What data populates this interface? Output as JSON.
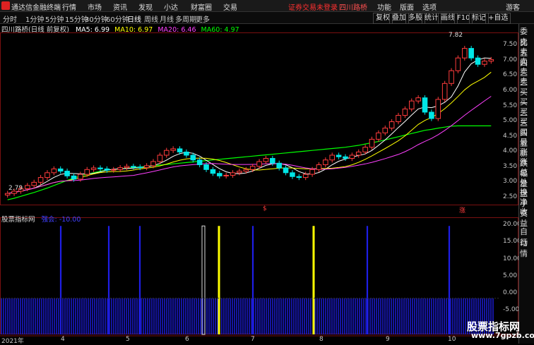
{
  "app": {
    "title": "通达信金融终端",
    "menus": [
      "行情",
      "市场",
      "资讯",
      "发现",
      "小达",
      "财富圈",
      "交易"
    ],
    "login_warning": "证券交易未登录",
    "stock_tab": "四川路桥",
    "right_menus": [
      "功能",
      "版面",
      "选项"
    ],
    "user": "游客"
  },
  "periods": [
    "分时",
    "1分钟",
    "5分钟",
    "15分钟",
    "30分钟",
    "60分钟",
    "日线",
    "周线",
    "月线",
    "多周期",
    "更多"
  ],
  "active_period": "日线",
  "toolbar_buttons": [
    "复权",
    "叠加",
    "多股",
    "统计",
    "画线",
    "F10",
    "标记",
    "+自选"
  ],
  "chart_header": {
    "stock_label": "四川路桥(日线 前复权)",
    "ma": [
      {
        "label": "MA5: 6.99",
        "color": "#ffffff"
      },
      {
        "label": "MA10: 6.97",
        "color": "#ffff00"
      },
      {
        "label": "MA20: 6.46",
        "color": "#ff40ff"
      },
      {
        "label": "MA60: 4.97",
        "color": "#00ff00"
      }
    ]
  },
  "price_axis": [
    "7.50",
    "7.00",
    "6.50",
    "6.00",
    "5.50",
    "5.00",
    "4.50",
    "4.00",
    "3.50",
    "3.00",
    "2.50"
  ],
  "price_marks": {
    "high": "7.82",
    "low": "2.79"
  },
  "event_markers": [
    "$",
    "涨"
  ],
  "indicator_header": {
    "name": "股票指标网",
    "value_label": "强会: -10.00"
  },
  "indicator_axis": [
    "20.00",
    "15.00",
    "10.00",
    "5.00",
    "0.00",
    "-5.00"
  ],
  "x_axis": [
    "2021年",
    "4",
    "5",
    "6",
    "7",
    "8",
    "9",
    "10"
  ],
  "right_panel": [
    "委比",
    "卖五",
    "卖四",
    "卖三",
    "卖二",
    "卖一",
    "买一",
    "买二",
    "买三",
    "买四",
    "买五",
    "最新",
    "涨跌",
    "涨幅",
    "总量",
    "外盘",
    "换手",
    "净资",
    "收益"
  ],
  "right_panel_bottom": [
    "自动",
    "行情"
  ],
  "watermark": {
    "line1": "股票指标网",
    "line2": "www.7gpzb.com"
  },
  "colors": {
    "up": "#ff3c3c",
    "down": "#00e6e6",
    "ma5": "#ffffff",
    "ma10": "#ffff00",
    "ma20": "#ff40ff",
    "ma60": "#00ff00",
    "bar_blue": "#1e1ee6",
    "bar_yellow": "#ffff00"
  },
  "chart_data": [
    {
      "type": "candlestick",
      "title": "四川路桥(日线 前复权)",
      "x_ticks": [
        "2021年",
        "4",
        "5",
        "6",
        "7",
        "8",
        "9",
        "10"
      ],
      "y_ticks": [
        2.5,
        3.0,
        3.5,
        4.0,
        4.5,
        5.0,
        5.5,
        6.0,
        6.5,
        7.0,
        7.5
      ],
      "ylim": [
        2.5,
        7.9
      ],
      "series": [
        {
          "name": "close",
          "values": [
            2.85,
            2.92,
            3.0,
            3.1,
            3.2,
            3.35,
            3.5,
            3.62,
            3.55,
            3.4,
            3.3,
            3.45,
            3.6,
            3.65,
            3.62,
            3.58,
            3.6,
            3.66,
            3.7,
            3.68,
            3.66,
            3.72,
            3.85,
            4.05,
            4.2,
            4.25,
            4.15,
            4.05,
            3.9,
            3.75,
            3.6,
            3.48,
            3.4,
            3.42,
            3.5,
            3.55,
            3.6,
            3.7,
            3.85,
            3.95,
            3.8,
            3.65,
            3.5,
            3.38,
            3.35,
            3.45,
            3.6,
            3.75,
            3.9,
            4.05,
            4.0,
            3.95,
            4.05,
            4.15,
            4.3,
            4.55,
            4.75,
            4.9,
            5.1,
            5.3,
            5.5,
            5.75,
            5.85,
            5.4,
            5.2,
            5.8,
            6.3,
            6.7,
            7.1,
            7.4,
            7.1,
            6.9,
            7.0,
            7.05
          ]
        },
        {
          "name": "MA60",
          "values": [
            2.65,
            2.7,
            2.76,
            2.82,
            2.88,
            2.95,
            3.02,
            3.1,
            3.18,
            3.26,
            3.33,
            3.4,
            3.45,
            3.5,
            3.55,
            3.58,
            3.6,
            3.62,
            3.64,
            3.66,
            3.68,
            3.7,
            3.72,
            3.74,
            3.76,
            3.78,
            3.8,
            3.82,
            3.84,
            3.86,
            3.88,
            3.9,
            3.92,
            3.94,
            3.96,
            3.98,
            4.0,
            4.02,
            4.04,
            4.06,
            4.08,
            4.1,
            4.12,
            4.14,
            4.16,
            4.18,
            4.2,
            4.22,
            4.24,
            4.26,
            4.28,
            4.3,
            4.33,
            4.36,
            4.4,
            4.44,
            4.48,
            4.53,
            4.58,
            4.63,
            4.68,
            4.73,
            4.78,
            4.83,
            4.86,
            4.9,
            4.93,
            4.96,
            4.97,
            4.97,
            4.97,
            4.97,
            4.97,
            4.97
          ]
        }
      ]
    },
    {
      "type": "bar",
      "title": "股票指标网",
      "ylim": [
        -10,
        22
      ],
      "y_ticks": [
        -5,
        0,
        5,
        10,
        15,
        20
      ],
      "series": [
        {
          "name": "base",
          "value": -10
        },
        {
          "name": "spike",
          "value": 20
        }
      ]
    }
  ]
}
